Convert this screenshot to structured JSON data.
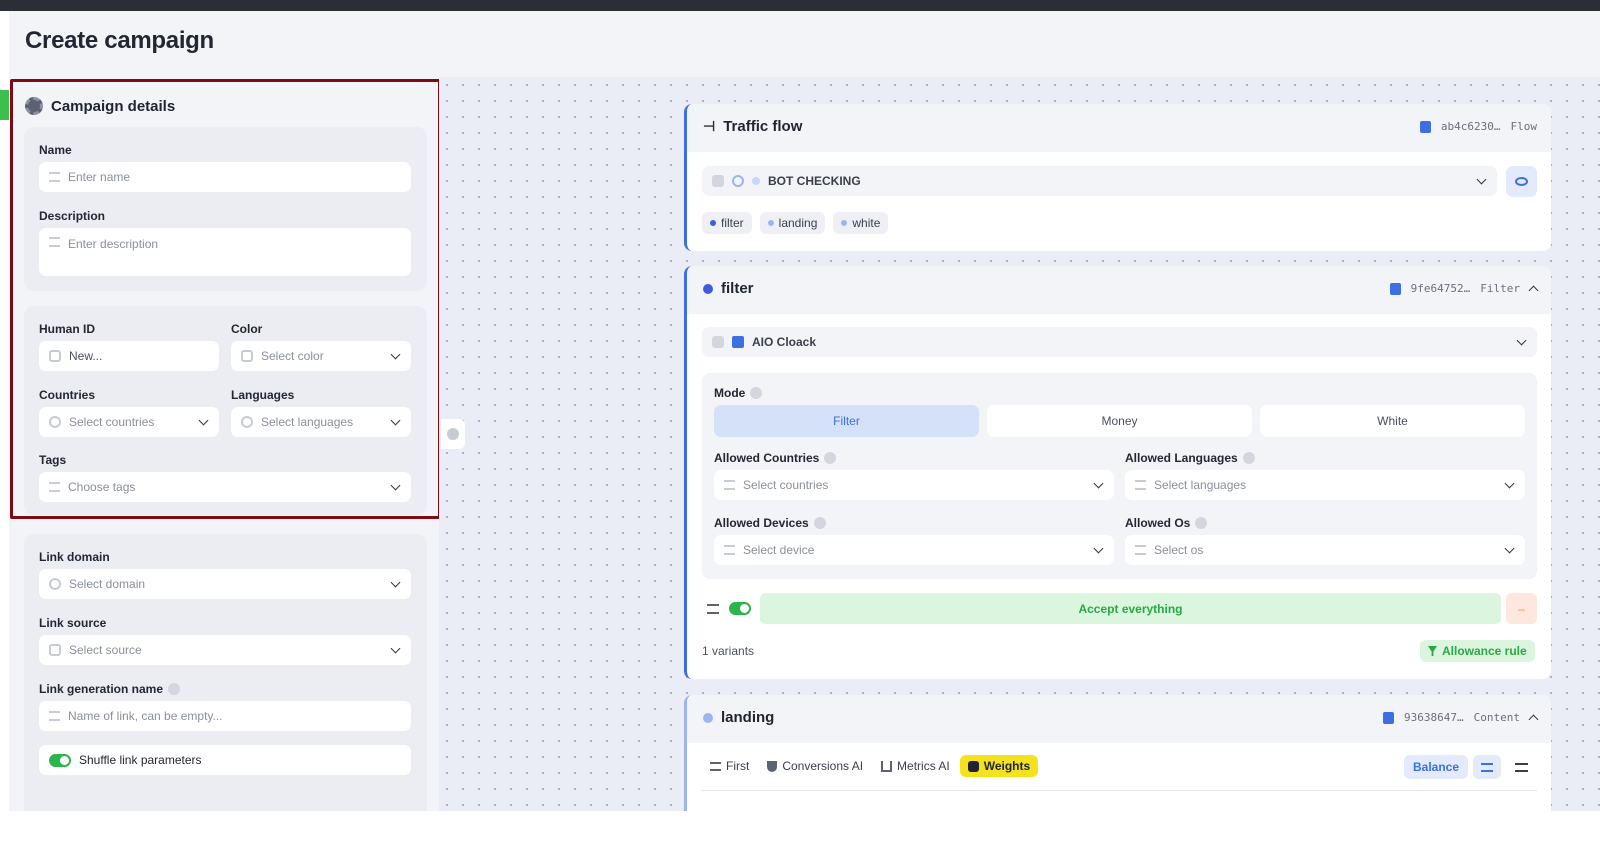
{
  "page": {
    "title": "Create campaign"
  },
  "campaign_details": {
    "title": "Campaign details",
    "name": {
      "label": "Name",
      "placeholder": "Enter name"
    },
    "description": {
      "label": "Description",
      "placeholder": "Enter description"
    },
    "human_id": {
      "label": "Human ID",
      "placeholder": "New..."
    },
    "color": {
      "label": "Color",
      "placeholder": "Select color"
    },
    "countries": {
      "label": "Countries",
      "placeholder": "Select countries"
    },
    "languages": {
      "label": "Languages",
      "placeholder": "Select languages"
    },
    "tags": {
      "label": "Tags",
      "placeholder": "Choose tags"
    }
  },
  "link_settings": {
    "domain": {
      "label": "Link domain",
      "placeholder": "Select domain"
    },
    "source": {
      "label": "Link source",
      "placeholder": "Select source"
    },
    "gen_name": {
      "label": "Link generation name",
      "placeholder": "Name of link, can be empty..."
    },
    "shuffle": {
      "label": "Shuffle link parameters",
      "checked": true
    }
  },
  "traffic_flow": {
    "title": "Traffic flow",
    "id": "ab4c6230…",
    "type": "Flow",
    "select": "BOT CHECKING",
    "chips": [
      {
        "label": "filter",
        "color": "#3d5ce0"
      },
      {
        "label": "landing",
        "color": "#9db4f0"
      },
      {
        "label": "white",
        "color": "#9db4f0"
      }
    ]
  },
  "filter_node": {
    "title": "filter",
    "id": "9fe64752…",
    "type": "Filter",
    "select": "AIO Cloack",
    "mode_label": "Mode",
    "modes": [
      "Filter",
      "Money",
      "White"
    ],
    "active_mode": "Filter",
    "allowed_countries": {
      "label": "Allowed Countries",
      "placeholder": "Select countries"
    },
    "allowed_languages": {
      "label": "Allowed Languages",
      "placeholder": "Select languages"
    },
    "allowed_devices": {
      "label": "Allowed Devices",
      "placeholder": "Select device"
    },
    "allowed_os": {
      "label": "Allowed Os",
      "placeholder": "Select os"
    },
    "rule": "Accept everything",
    "remove": "–",
    "variants": "1 variants",
    "allowance_button": "Allowance rule"
  },
  "landing_node": {
    "title": "landing",
    "id": "93638647…",
    "type": "Content",
    "tabs": [
      "First",
      "Conversions AI",
      "Metrics AI",
      "Weights"
    ],
    "active_tab": "Weights",
    "balance": "Balance"
  },
  "colors": {
    "accent": "#3d6fe0",
    "highlight_border": "#7d0a14",
    "accept_bg": "#dcf5df",
    "accept_text": "#2aa845",
    "weights_bg": "#f4e21f"
  }
}
